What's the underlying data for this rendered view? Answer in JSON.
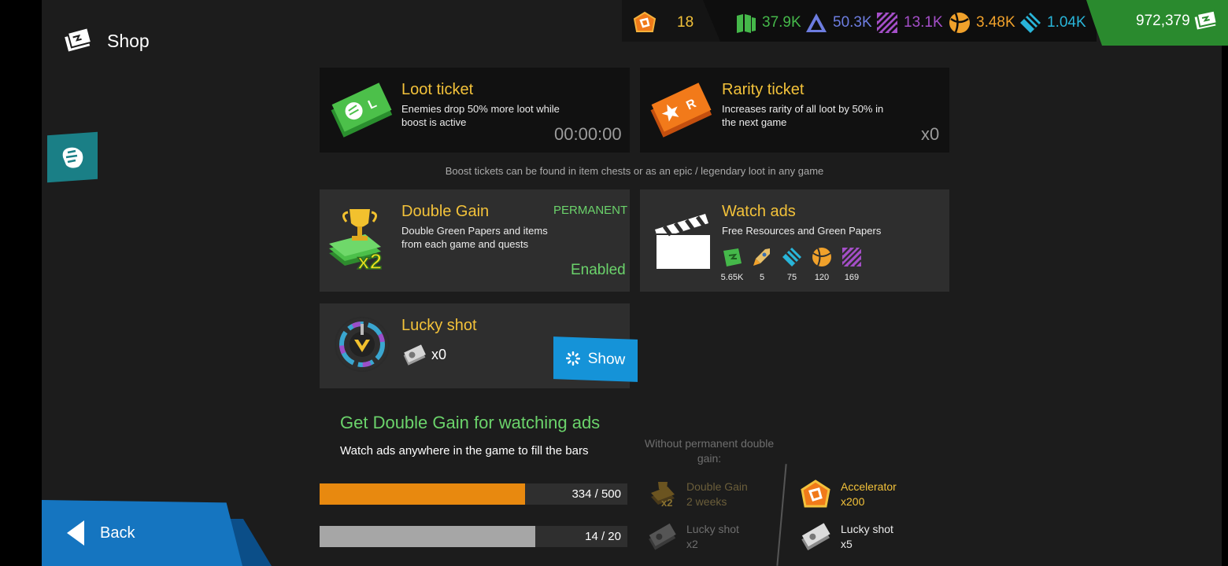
{
  "header": {
    "title": "Shop",
    "title_icon": "shop-ticket-icon"
  },
  "resources": {
    "tickets": "18",
    "items": [
      {
        "icon": "green-papers-icon",
        "value": "37.9K",
        "color": "#45b84a"
      },
      {
        "icon": "triangle-resource-icon",
        "value": "50.3K",
        "color": "#6d7de0"
      },
      {
        "icon": "purple-stripes-icon",
        "value": "13.1K",
        "color": "#a54fc9"
      },
      {
        "icon": "orange-ball-icon",
        "value": "3.48K",
        "color": "#f0a12b"
      },
      {
        "icon": "cyan-diamond-icon",
        "value": "1.04K",
        "color": "#29b5d9"
      }
    ],
    "cash": "972,379"
  },
  "loot_ticket": {
    "title": "Loot ticket",
    "desc": "Enemies drop 50% more loot while boost is active",
    "timer": "00:00:00"
  },
  "rarity_ticket": {
    "title": "Rarity ticket",
    "desc": "Increases rarity of all loot by 50% in the next game",
    "count": "x0"
  },
  "note": "Boost tickets can be found in item chests or as an epic / legendary loot in any game",
  "double_gain": {
    "title": "Double Gain",
    "badge": "PERMANENT",
    "desc": "Double Green Papers and items from each game and quests",
    "status": "Enabled"
  },
  "watch_ads": {
    "title": "Watch ads",
    "desc": "Free Resources and Green Papers",
    "rewards": [
      {
        "icon": "green-papers-icon",
        "value": "5.65K"
      },
      {
        "icon": "rocket-icon",
        "value": "5"
      },
      {
        "icon": "cyan-diamond-icon",
        "value": "75"
      },
      {
        "icon": "orange-ball-icon",
        "value": "120"
      },
      {
        "icon": "purple-stripes-icon",
        "value": "169"
      }
    ]
  },
  "lucky_shot": {
    "title": "Lucky shot",
    "count": "x0",
    "button": "Show"
  },
  "double_gain_ads": {
    "title": "Get Double Gain for watching ads",
    "subtitle": "Watch ads anywhere in the game to fill the bars",
    "bar1": {
      "text": "334 / 500",
      "progress": 0.668,
      "color": "#e8890f"
    },
    "bar2": {
      "text": "14 / 20",
      "progress": 0.7,
      "color": "#a6a6a6"
    },
    "without_label": "Without permanent double gain:",
    "rewards_locked": [
      {
        "name": "Double Gain",
        "amount": "2 weeks"
      },
      {
        "name": "Lucky shot",
        "amount": "x2"
      }
    ],
    "rewards_active": [
      {
        "name": "Accelerator",
        "amount": "x200"
      },
      {
        "name": "Lucky shot",
        "amount": "x5"
      }
    ]
  },
  "back": {
    "label": "Back"
  }
}
